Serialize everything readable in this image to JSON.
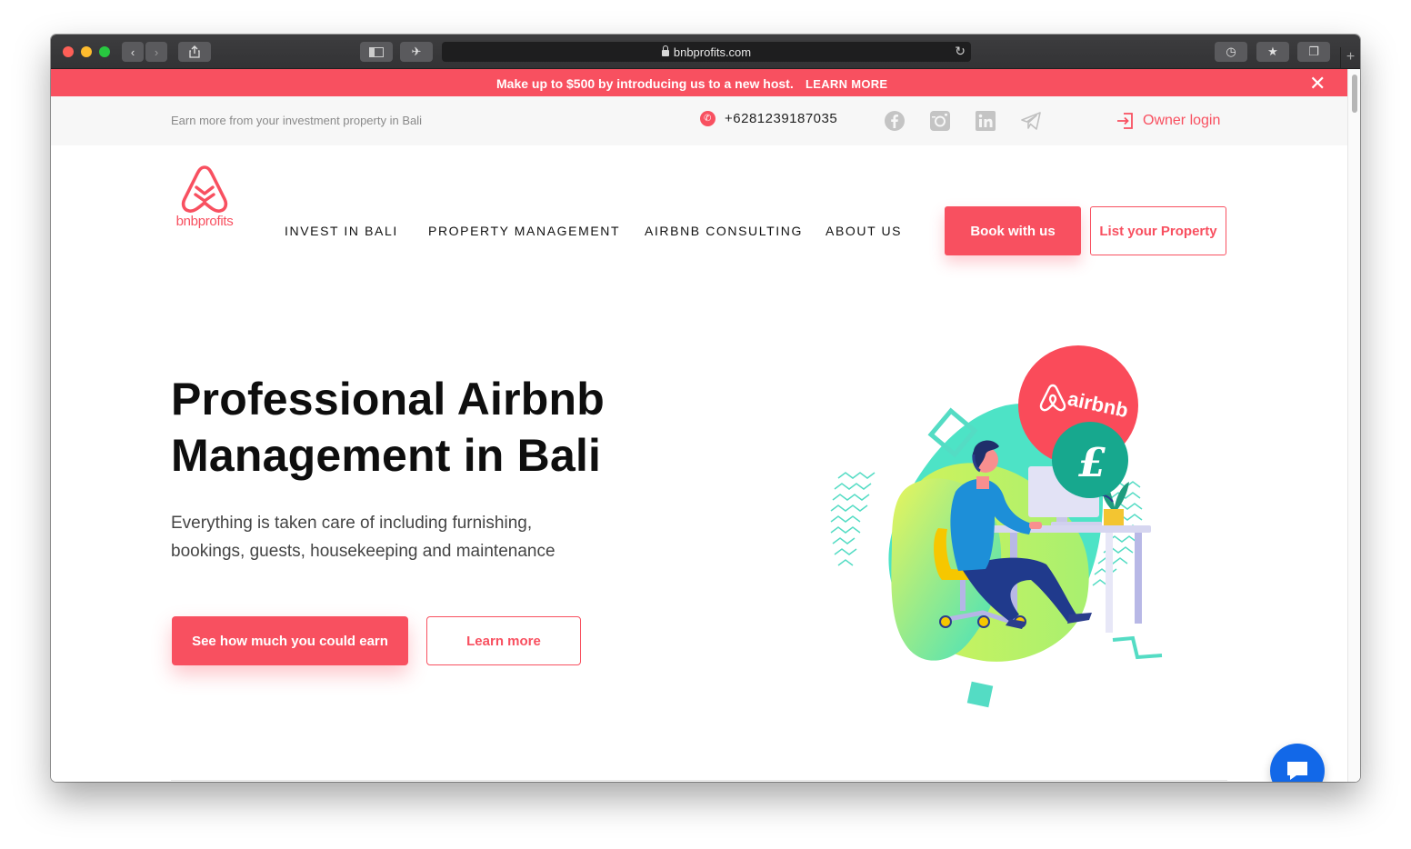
{
  "browser": {
    "url": "bnbprofits.com"
  },
  "promo": {
    "text": "Make up to $500 by introducing us to a new host.",
    "link": "LEARN MORE"
  },
  "topbar": {
    "tagline": "Earn more from your investment property in Bali",
    "phone": "+6281239187035",
    "owner_login": "Owner login"
  },
  "logo": {
    "text": "bnbprofits"
  },
  "nav": {
    "items": [
      "INVEST IN BALI",
      "PROPERTY MANAGEMENT",
      "AIRBNB CONSULTING",
      "ABOUT US"
    ],
    "book_button": "Book with us",
    "list_button": "List your Property"
  },
  "hero": {
    "title_line1": "Professional Airbnb",
    "title_line2": "Management in Bali",
    "subtitle_line1": "Everything is taken care of including furnishing,",
    "subtitle_line2": "bookings, guests, housekeeping and maintenance",
    "cta_primary": "See how much you could earn",
    "cta_secondary": "Learn more"
  },
  "illustration": {
    "badge_brand": "airbnb",
    "badge_currency": "£"
  },
  "colors": {
    "brand": "#f85060",
    "chat": "#1268e8",
    "teal": "#17a88e"
  },
  "icons": [
    "lock-icon",
    "reload-icon",
    "close-icon",
    "whatsapp-icon",
    "facebook-icon",
    "instagram-icon",
    "linkedin-icon",
    "telegram-icon",
    "login-icon",
    "chat-icon"
  ]
}
